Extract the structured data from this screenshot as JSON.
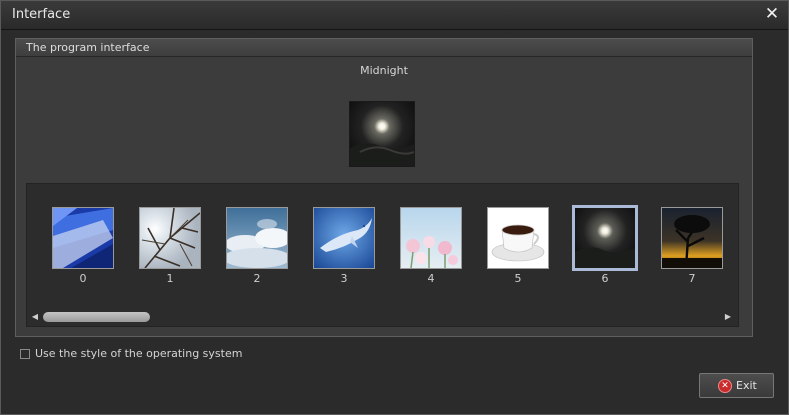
{
  "window": {
    "title": "Interface",
    "close_icon": "close-icon"
  },
  "group": {
    "title": "The program interface",
    "current_theme": "Midnight"
  },
  "themes": [
    {
      "label": "0",
      "image": "blue-abstract"
    },
    {
      "label": "1",
      "image": "bare-branches"
    },
    {
      "label": "2",
      "image": "sky-clouds"
    },
    {
      "label": "3",
      "image": "flying-whale"
    },
    {
      "label": "4",
      "image": "pink-flowers"
    },
    {
      "label": "5",
      "image": "coffee-cup"
    },
    {
      "label": "6",
      "image": "midnight-moon",
      "selected": true
    },
    {
      "label": "7",
      "image": "tree-sunset"
    }
  ],
  "scroll": {
    "left_icon": "arrow-left-icon",
    "right_icon": "arrow-right-icon"
  },
  "os_style": {
    "label": "Use the style of the operating system",
    "checked": false
  },
  "exit": {
    "label": "Exit",
    "icon": "exit-icon"
  },
  "colors": {
    "background": "#2b2b2b",
    "selection": "#a9bbd6",
    "exit_icon": "#c92a2a"
  }
}
